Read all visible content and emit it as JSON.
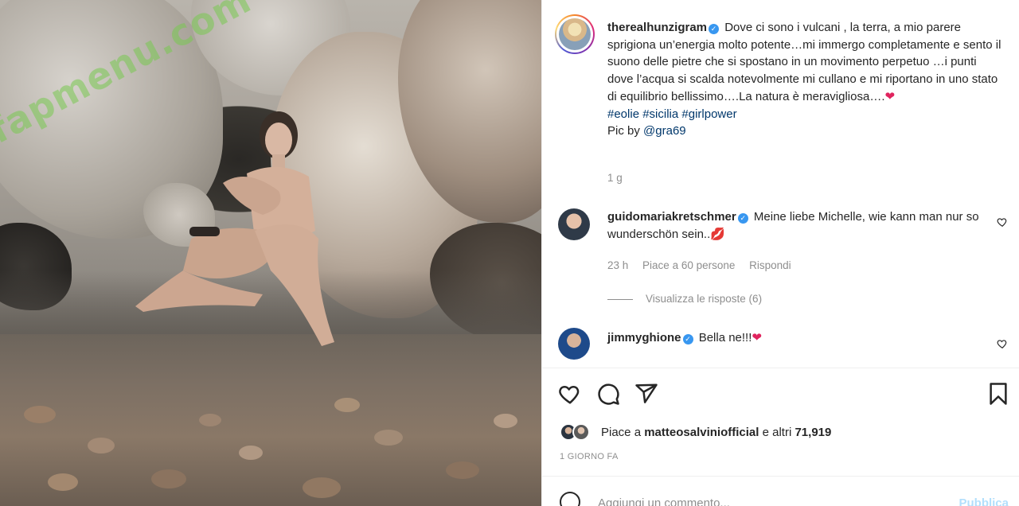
{
  "watermark": "fapmenu.com",
  "post": {
    "author": "therealhunzigram",
    "caption": "Dove ci sono i vulcani , la terra, a mio parere sprigiona un’energia molto potente…mi immergo completamente e sento il suono delle pietre che si spostano in un movimento perpetuo …i punti dove l’acqua si scalda notevolmente mi cullano e mi riportano in uno stato di equilibrio bellissimo….La natura è meravigliosa….",
    "caption_heart": "❤",
    "hashtags": [
      "#eolie",
      "#sicilia",
      "#girlpower"
    ],
    "pic_by_label": "Pic by",
    "pic_by_mention": "@gra69",
    "age": "1 g"
  },
  "comments": [
    {
      "username": "guidomariakretschmer",
      "text": "Meine liebe Michelle, wie kann man nur so wunderschön sein..",
      "emoji": "💋",
      "time": "23 h",
      "likes": "Piace a 60 persone",
      "reply": "Rispondi",
      "view_replies": "Visualizza le risposte (6)"
    },
    {
      "username": "jimmyghione",
      "text": "Bella ne!!!",
      "emoji": "❤"
    }
  ],
  "likes": {
    "prefix": "Piace a",
    "user": "matteosalviniofficial",
    "connector": "e altri",
    "count": "71,919"
  },
  "timestamp": "1 GIORNO FA",
  "add_comment": {
    "placeholder": "Aggiungi un commento...",
    "publish": "Pubblica"
  },
  "icons": {
    "like": "heart-icon",
    "comment": "comment-icon",
    "share": "share-icon",
    "save": "bookmark-icon",
    "emoji": "emoji-icon",
    "comment_like": "small-heart-icon"
  },
  "colors": {
    "link": "#00376b",
    "verified": "#3897f0",
    "heart": "#e0245e",
    "muted": "#8e8e8e"
  }
}
